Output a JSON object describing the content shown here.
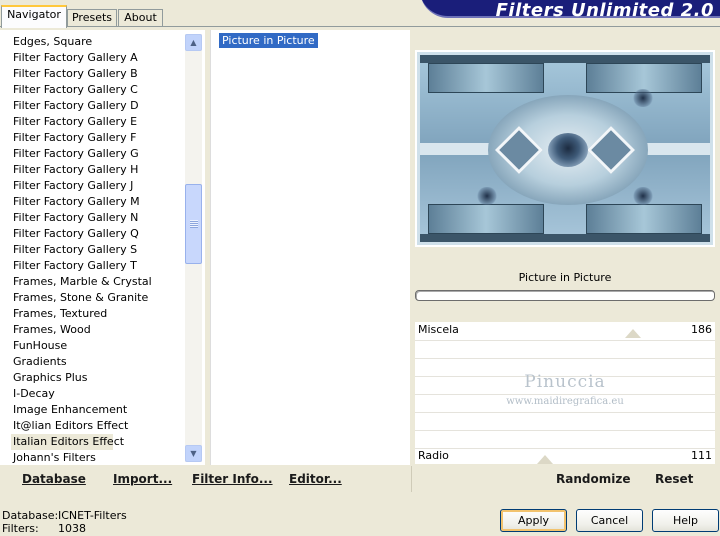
{
  "tabs": [
    "Navigator",
    "Presets",
    "About"
  ],
  "app_title": "Filters Unlimited 2.0",
  "categories": [
    "Edges, Square",
    "Filter Factory Gallery A",
    "Filter Factory Gallery B",
    "Filter Factory Gallery C",
    "Filter Factory Gallery D",
    "Filter Factory Gallery E",
    "Filter Factory Gallery F",
    "Filter Factory Gallery G",
    "Filter Factory Gallery H",
    "Filter Factory Gallery J",
    "Filter Factory Gallery M",
    "Filter Factory Gallery N",
    "Filter Factory Gallery Q",
    "Filter Factory Gallery S",
    "Filter Factory Gallery T",
    "Frames, Marble & Crystal",
    "Frames, Stone & Granite",
    "Frames, Textured",
    "Frames, Wood",
    "FunHouse",
    "Gradients",
    "Graphics Plus",
    "I-Decay",
    "Image Enhancement",
    "It@lian Editors Effect",
    "Italian Editors Effect",
    "Johann's Filters"
  ],
  "selected_category": "Italian Editors Effect",
  "filters": [
    "Picture in Picture"
  ],
  "selected_filter": "Picture in Picture",
  "preview_caption": "Picture in Picture",
  "sliders": [
    {
      "label": "Miscela",
      "value": "186"
    },
    {
      "label": "Radio",
      "value": "111"
    }
  ],
  "watermark": {
    "name": "Pinuccia",
    "url": "www.maidiregrafica.eu"
  },
  "toolbar_left": {
    "database": "Database",
    "import": "Import...",
    "filter_info": "Filter Info...",
    "editor": "Editor..."
  },
  "toolbar_right": {
    "randomize": "Randomize",
    "reset": "Reset"
  },
  "status": {
    "database_label": "Database:",
    "database_value": "ICNET-Filters",
    "filters_label": "Filters:",
    "filters_value": "1038"
  },
  "buttons": {
    "apply": "Apply",
    "cancel": "Cancel",
    "help": "Help"
  },
  "colors": {
    "selection": "#316ac5",
    "banner": "#1a1e7a",
    "dialog_bg": "#ece9d8"
  }
}
